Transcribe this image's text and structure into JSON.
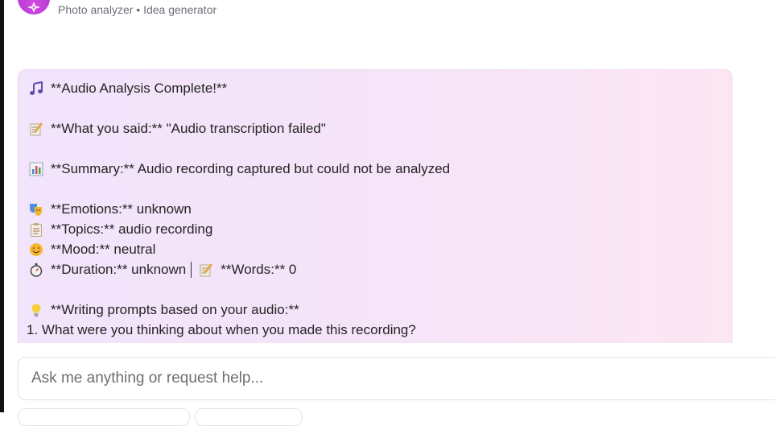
{
  "header": {
    "subtitle": "Photo analyzer • Idea generator",
    "avatar_icon": "sparkle-icon"
  },
  "message": {
    "lines": [
      {
        "icon": "music-note-icon",
        "text": "**Audio Analysis Complete!**"
      },
      {
        "icon": "memo-icon",
        "text": "**What you said:** \"Audio transcription failed\""
      },
      {
        "icon": "bar-chart-icon",
        "text": "**Summary:** Audio recording captured but could not be analyzed"
      },
      {
        "icon": "theater-masks-icon",
        "text": "**Emotions:** unknown"
      },
      {
        "icon": "clipboard-icon",
        "text": "**Topics:** audio recording"
      },
      {
        "icon": "smiley-icon",
        "text": "**Mood:** neutral"
      },
      {
        "icon": "stopwatch-icon",
        "text": "**Duration:** unknown"
      },
      {
        "icon": "memo-icon",
        "text": "**Words:** 0"
      },
      {
        "icon": "lightbulb-icon",
        "text": "**Writing prompts based on your audio:**"
      },
      {
        "icon": "",
        "text": "1. What were you thinking about when you made this recording?"
      }
    ]
  },
  "composer": {
    "placeholder": "Ask me anything or request help..."
  },
  "colors": {
    "card_gradient_start": "#f1e4fb",
    "card_gradient_end": "#fbe6f2",
    "avatar": "#c13fd9"
  }
}
